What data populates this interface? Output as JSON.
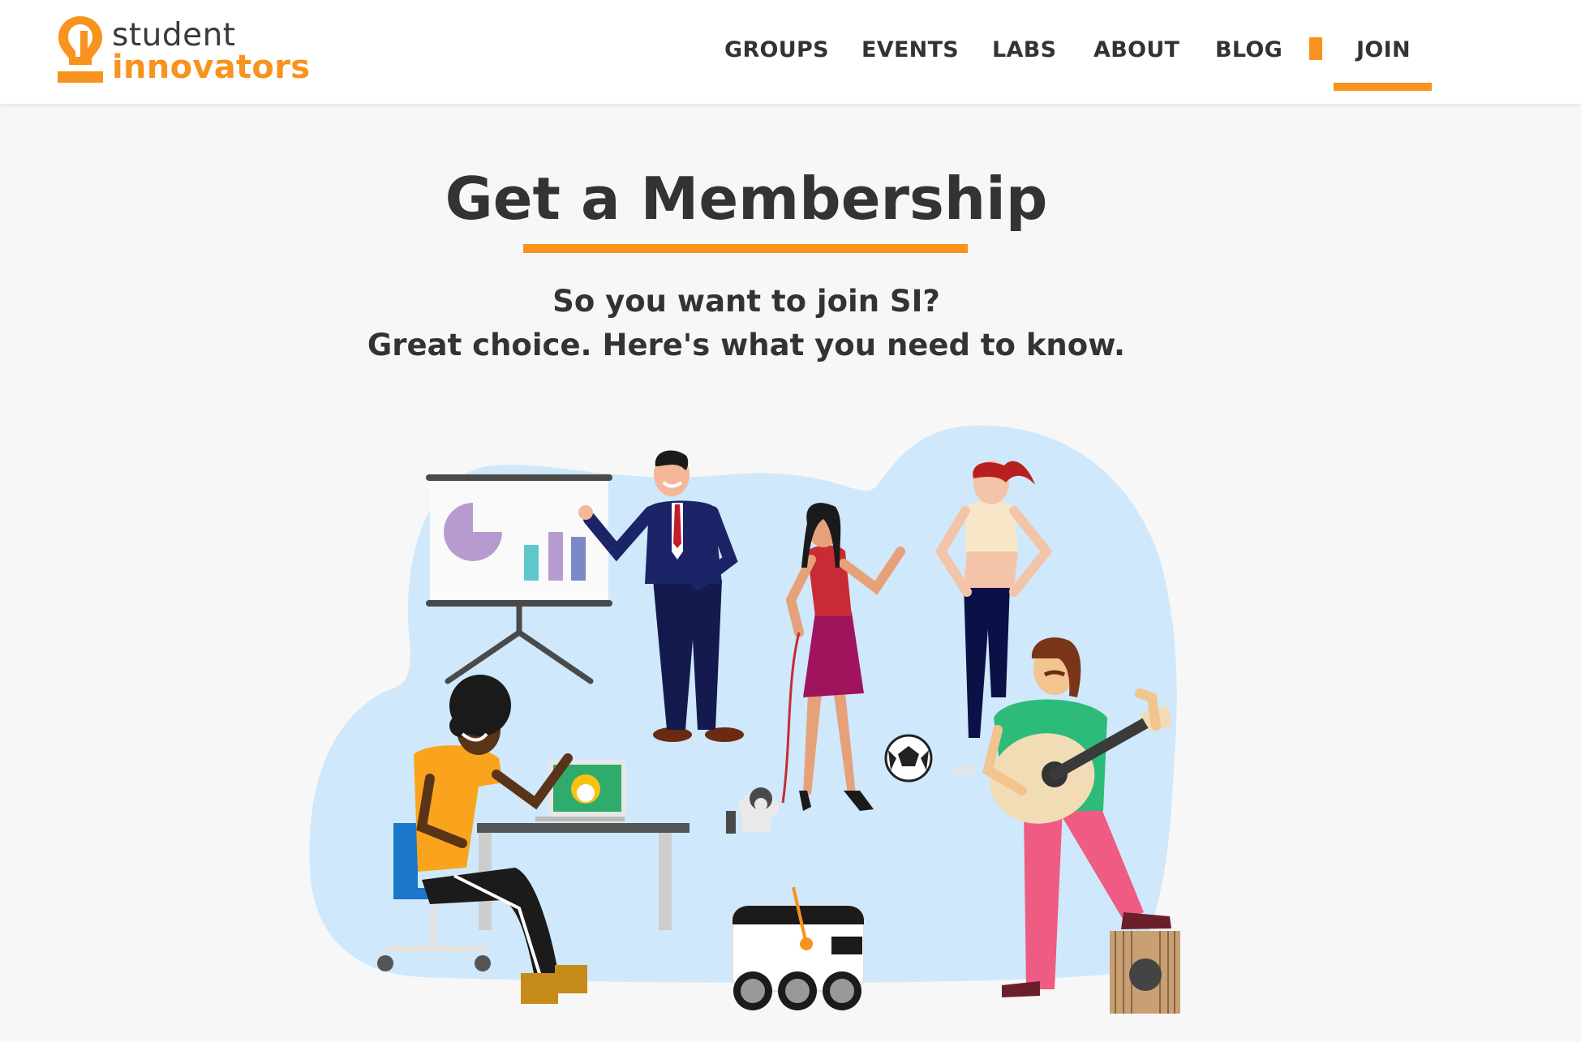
{
  "logo": {
    "line1": "student",
    "line2": "innovators",
    "icon": "lightbulb-icon"
  },
  "nav": {
    "items": [
      {
        "label": "GROUPS"
      },
      {
        "label": "EVENTS"
      },
      {
        "label": "LABS"
      },
      {
        "label": "ABOUT"
      },
      {
        "label": "BLOG"
      },
      {
        "label": "JOIN",
        "active": true
      }
    ]
  },
  "hero": {
    "title": "Get a Membership",
    "subtitle_line1": "So you want to join SI?",
    "subtitle_line2": "Great choice. Here's what you need to know."
  },
  "colors": {
    "accent": "#f7931e",
    "text": "#333333",
    "background": "#f7f7f7",
    "blob": "#cfe8fb"
  }
}
